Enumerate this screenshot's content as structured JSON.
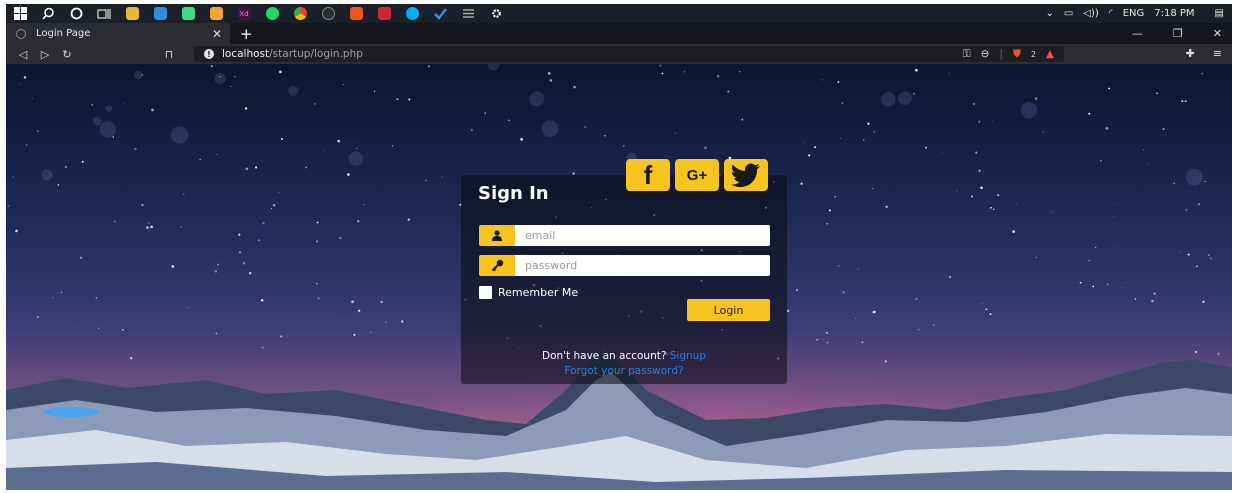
{
  "taskbar": {
    "icons": [
      "windows-start-icon",
      "search-icon",
      "cortana-icon",
      "task-view-icon",
      "file-explorer-icon",
      "vscode-icon",
      "android-studio-icon",
      "mail-icon",
      "xd-icon",
      "whatsapp-icon",
      "chrome-icon",
      "php-icon",
      "brave-icon",
      "red-app-icon",
      "skype-icon",
      "todo-icon",
      "list-icon",
      "settings-icon"
    ],
    "language": "ENG",
    "time": "7:18 PM"
  },
  "browser": {
    "tab_title": "Login Page",
    "url_host": "localhost",
    "url_path": "/startup/login.php",
    "brave_badge": "2"
  },
  "login": {
    "title": "Sign In",
    "social": [
      "facebook",
      "google-plus",
      "twitter"
    ],
    "social_labels": {
      "facebook": "f",
      "google_plus": "G+"
    },
    "email_placeholder": "email",
    "password_placeholder": "password",
    "remember_label": "Remember Me",
    "login_button": "Login",
    "no_account_text": "Don't have an account?",
    "signup_link": "Signup",
    "forgot_link": "Forgot your password?"
  },
  "colors": {
    "accent": "#f7c31e",
    "link": "#2f7de1",
    "browser_chrome": "#2b2d33"
  }
}
